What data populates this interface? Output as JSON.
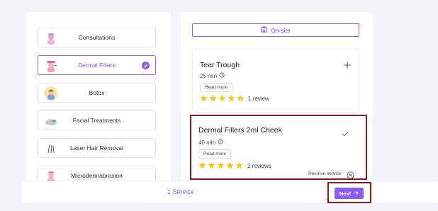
{
  "categories": [
    {
      "label": "Consultations",
      "icon": "consultation-avatar-icon",
      "selected": false
    },
    {
      "label": "Dermal Fillers",
      "icon": "dermal-fillers-avatar-icon",
      "selected": true
    },
    {
      "label": "Botox",
      "icon": "botox-avatar-icon",
      "selected": false
    },
    {
      "label": "Facial Treatments",
      "icon": "facial-treatment-avatar-icon",
      "selected": false
    },
    {
      "label": "Laser Hair Removal",
      "icon": "laser-hair-removal-icon",
      "selected": false
    },
    {
      "label": "Microdermabrasion",
      "icon": "microdermabrasion-avatar-icon",
      "selected": false
    }
  ],
  "location_button": {
    "label": "On-site",
    "icon": "building-icon"
  },
  "services": [
    {
      "name": "Tear Trough",
      "duration": "25 min",
      "read_more": "Read more",
      "rating": 5,
      "reviews": "1 review",
      "action_icon": "plus-icon",
      "selected": false
    },
    {
      "name": "Dermal Fillers 2ml Cheek",
      "duration": "40 min",
      "read_more": "Read more",
      "rating": 5,
      "reviews": "2 reviews",
      "action_icon": "checkmark-icon",
      "selected": true,
      "remove_label": "Remove service"
    }
  ],
  "footer": {
    "service_count": "1 Service",
    "next_label": "Next"
  },
  "colors": {
    "accent": "#8b5cf6",
    "star": "#f5c518",
    "highlight_border": "#8b1c1c"
  }
}
